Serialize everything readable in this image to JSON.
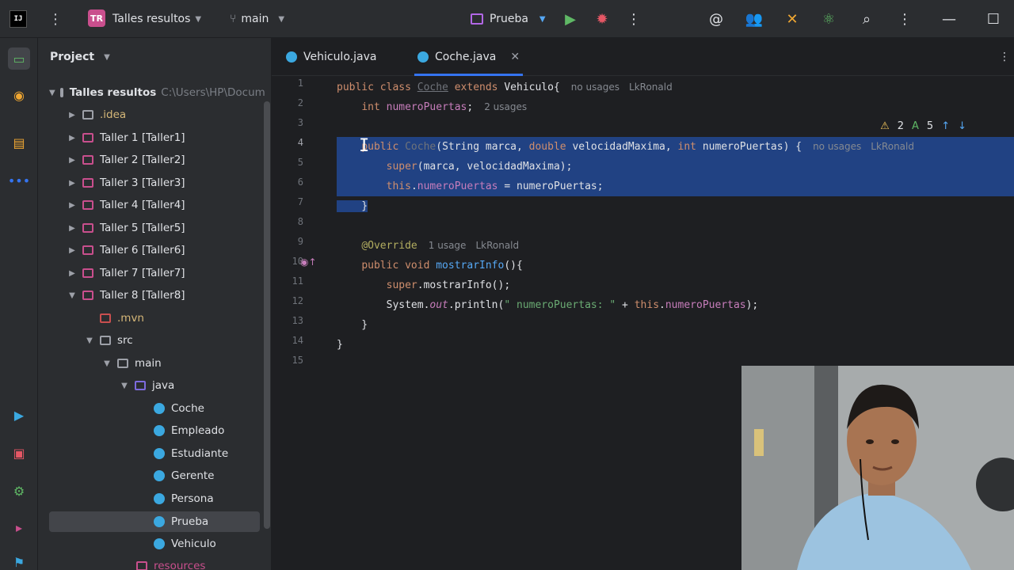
{
  "topbar": {
    "logo": "IJ",
    "project_badge": "TR",
    "project_name": "Talles resultos",
    "branch": "main",
    "run_config": "Prueba"
  },
  "project_panel": {
    "title": "Project",
    "tree": [
      {
        "label": "Talles resultos",
        "extra": "C:\\Users\\HP\\Docum"
      },
      {
        "label": ".idea"
      },
      {
        "label": "Taller 1 [Taller1]"
      },
      {
        "label": "Taller 2 [Taller2]"
      },
      {
        "label": "Taller 3 [Taller3]"
      },
      {
        "label": "Taller 4 [Taller4]"
      },
      {
        "label": "Taller 5 [Taller5]"
      },
      {
        "label": "Taller 6 [Taller6]"
      },
      {
        "label": "Taller 7 [Taller7]"
      },
      {
        "label": "Taller 8 [Taller8]"
      },
      {
        "label": ".mvn"
      },
      {
        "label": "src"
      },
      {
        "label": "main"
      },
      {
        "label": "java"
      },
      {
        "label": "Coche"
      },
      {
        "label": "Empleado"
      },
      {
        "label": "Estudiante"
      },
      {
        "label": "Gerente"
      },
      {
        "label": "Persona"
      },
      {
        "label": "Prueba"
      },
      {
        "label": "Vehiculo"
      },
      {
        "label": "resources"
      }
    ]
  },
  "editor": {
    "tabs": [
      "Vehiculo.java",
      "Coche.java"
    ],
    "active_tab": "Coche.java",
    "line_numbers": [
      "1",
      "2",
      "3",
      "4",
      "5",
      "6",
      "7",
      "8",
      "9",
      "10",
      "11",
      "12",
      "13",
      "14",
      "15"
    ],
    "hints": {
      "no_usages": "no usages",
      "two_usages": "2 usages",
      "one_usage": "1 usage",
      "author": "LkRonald"
    },
    "inspections": {
      "warnings": "2",
      "typos": "5"
    }
  },
  "colors": {
    "selection": "#214283",
    "keyword": "#cf8e6d",
    "field": "#c77dbb",
    "method": "#56a8f5",
    "string": "#6aab73",
    "accent": "#3574f0"
  }
}
